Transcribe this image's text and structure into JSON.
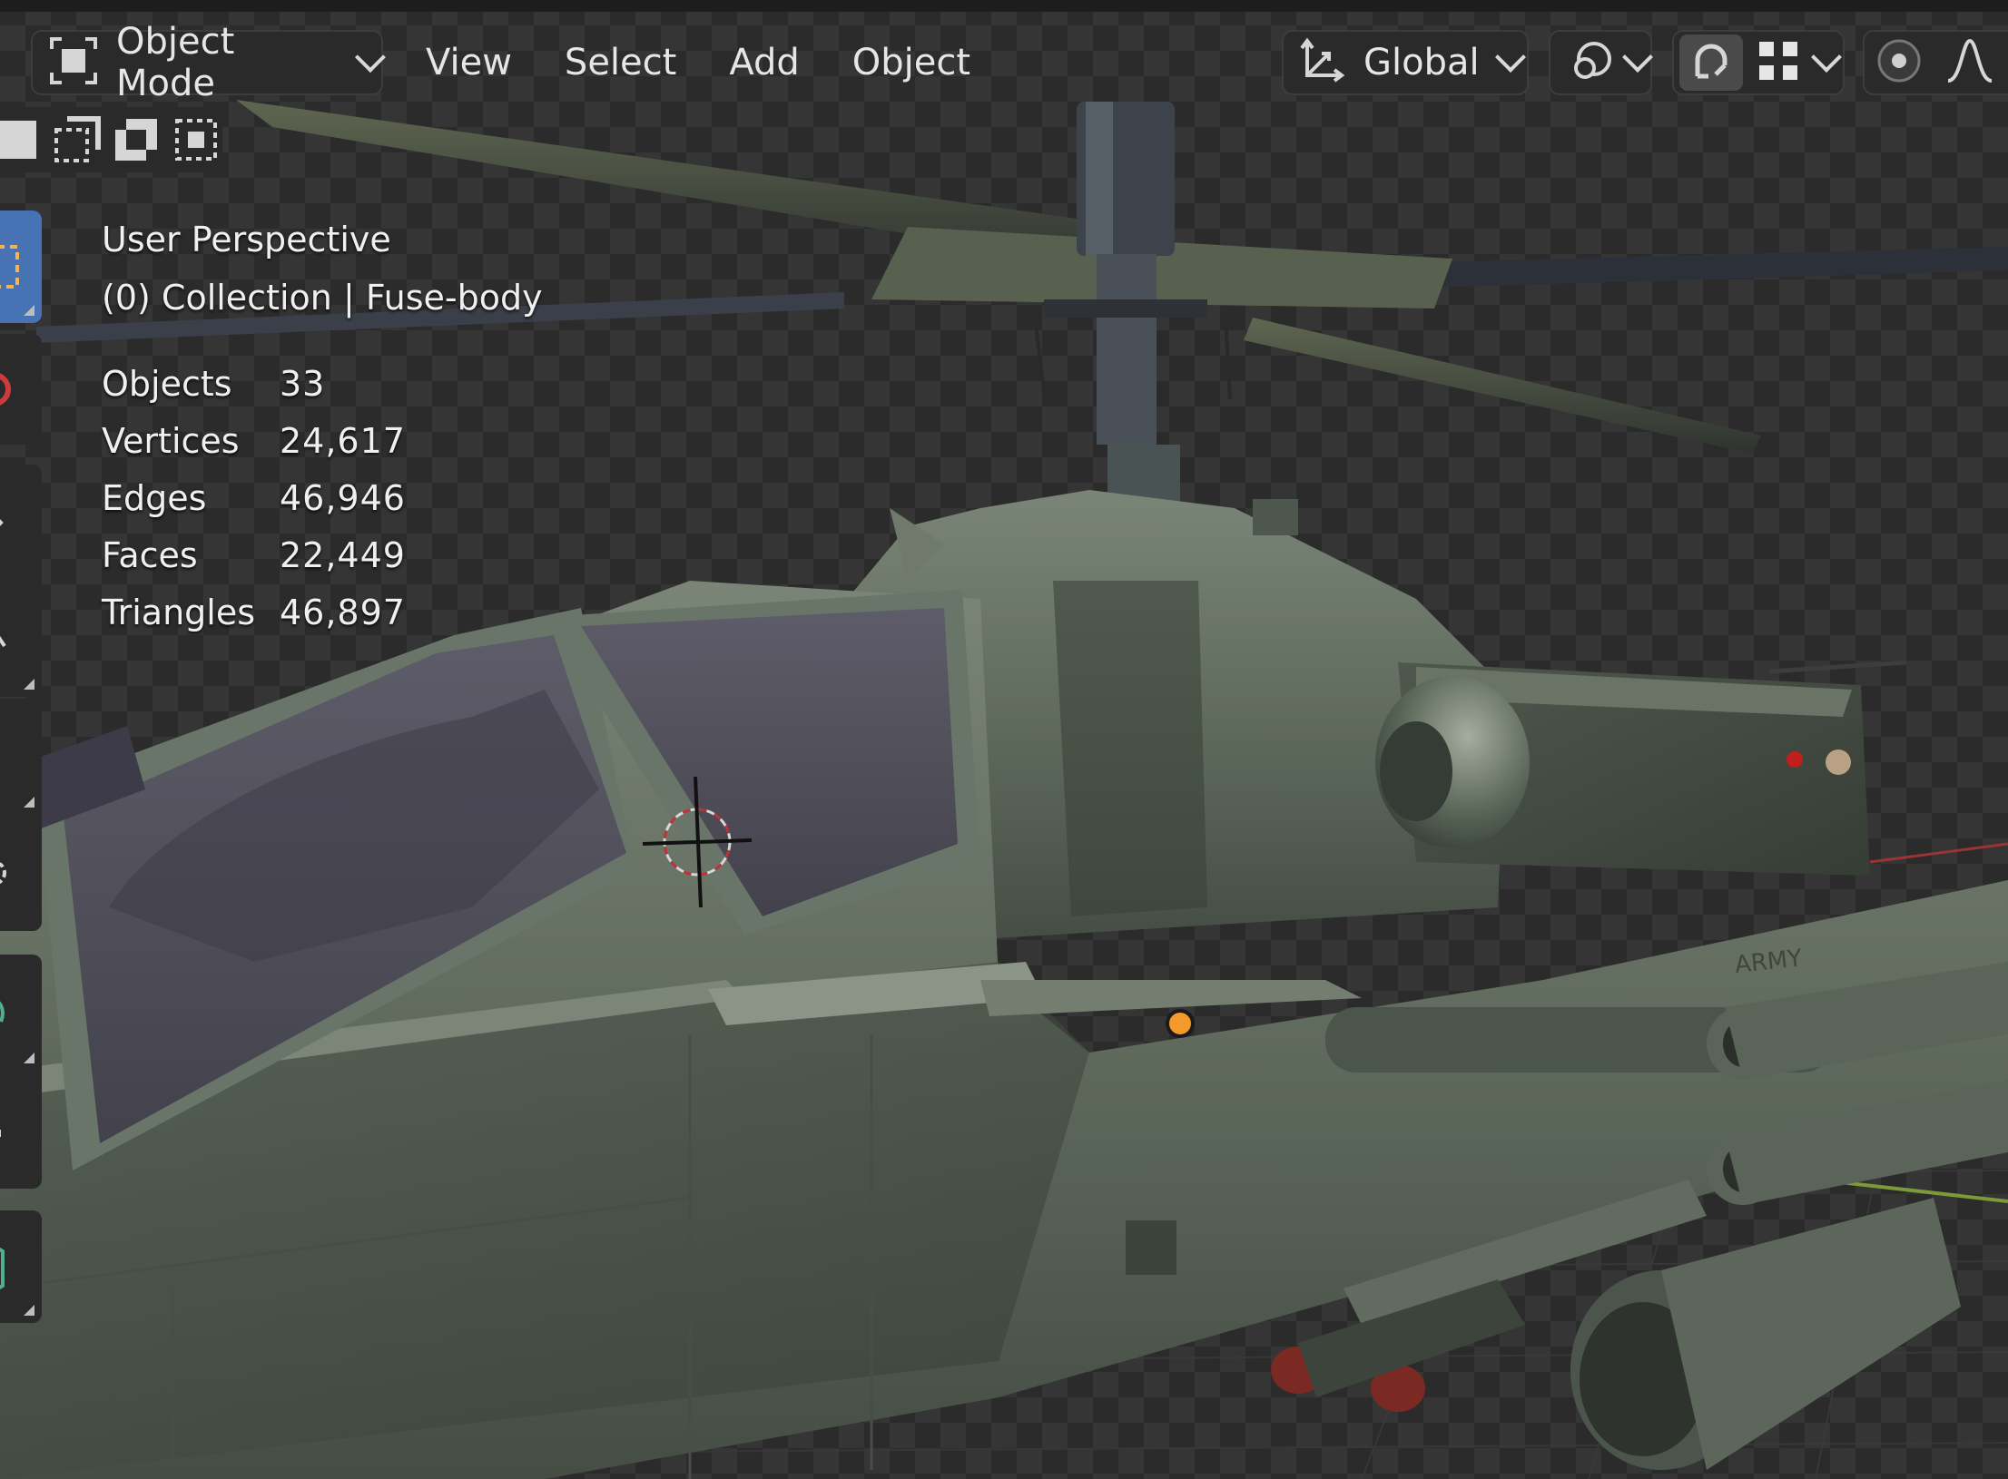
{
  "header": {
    "mode_label": "Object Mode",
    "menus": [
      "View",
      "Select",
      "Add",
      "Object"
    ],
    "transform_orientation": "Global"
  },
  "viewport": {
    "title": "User Perspective",
    "context": "(0) Collection | Fuse-body",
    "stats": [
      {
        "label": "Objects",
        "value": "33"
      },
      {
        "label": "Vertices",
        "value": "24,617"
      },
      {
        "label": "Edges",
        "value": "46,946"
      },
      {
        "label": "Faces",
        "value": "22,449"
      },
      {
        "label": "Triangles",
        "value": "46,897"
      }
    ],
    "hull_marking": "ARMY"
  },
  "colors": {
    "header_bg": "#2a2a2a",
    "active_tool": "#4772b3",
    "origin_dot": "#f39a2b",
    "checker_dark": "#2b2b2b",
    "checker_light": "#353535",
    "hull": "#5e6a5c"
  },
  "icons": {
    "mode": "object-mode-icon",
    "transform": "transform-orientation-icon",
    "pivot": "pivot-point-icon",
    "snap": "snap-magnet-icon",
    "snap_target": "snap-increment-icon",
    "proportional": "proportional-editing-icon",
    "falloff": "falloff-curve-icon"
  }
}
